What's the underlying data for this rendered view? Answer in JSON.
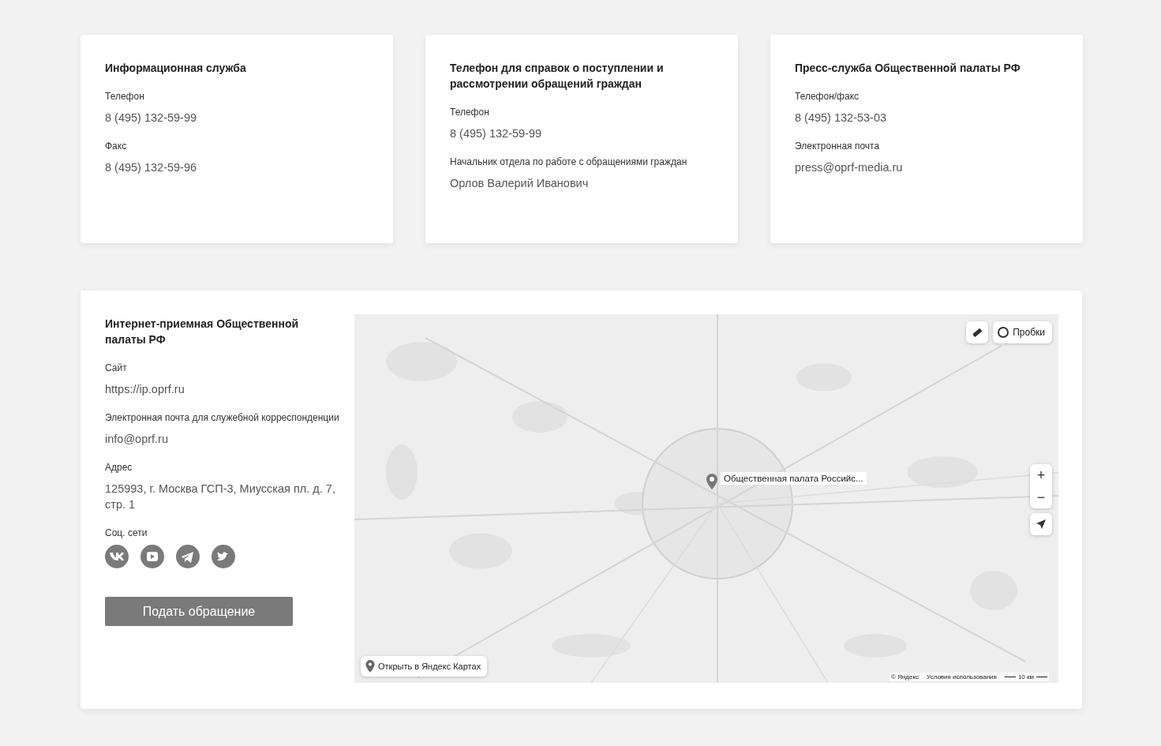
{
  "cards": [
    {
      "title": "Информационная служба",
      "fields": [
        {
          "label": "Телефон",
          "value": "8 (495) 132-59-99"
        },
        {
          "label": "Факс",
          "value": "8 (495) 132-59-96"
        }
      ]
    },
    {
      "title": "Телефон для справок о поступлении и рассмотрении обращений граждан",
      "fields": [
        {
          "label": "Телефон",
          "value": "8 (495) 132-59-99"
        },
        {
          "label": "Начальник отдела по работе с обращениями граждан",
          "value": "Орлов Валерий Иванович"
        }
      ]
    },
    {
      "title": "Пресс-служба Общественной палаты РФ",
      "fields": [
        {
          "label": "Телефон/факс",
          "value": "8 (495) 132-53-03"
        },
        {
          "label": "Электронная почта",
          "value": "press@oprf-media.ru"
        }
      ]
    }
  ],
  "reception": {
    "title": "Интернет-приемная Общественной палаты РФ",
    "fields": [
      {
        "label": "Сайт",
        "value": "https://ip.oprf.ru"
      },
      {
        "label": "Электронная почта для служебной корреспонденции",
        "value": "info@oprf.ru"
      },
      {
        "label": "Адрес",
        "value": "125993, г. Москва ГСП-3, Миусская пл. д. 7, стр. 1"
      }
    ],
    "social_label": "Соц. сети",
    "social": [
      {
        "kind": "vk"
      },
      {
        "kind": "youtube"
      },
      {
        "kind": "telegram"
      },
      {
        "kind": "twitter"
      }
    ],
    "button": "Подать обращение"
  },
  "map": {
    "traffic_button": "Пробки",
    "zoom_in": "+",
    "zoom_out": "−",
    "marker_label": "Общественная палата Российс...",
    "open_button": "Открыть в Яндекс Картах",
    "copyright": "© Яндекс",
    "terms": "Условия использования",
    "scale": "10 км"
  }
}
